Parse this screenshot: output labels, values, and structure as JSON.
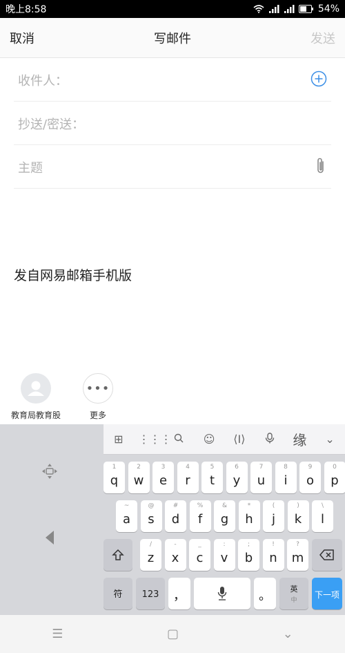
{
  "status": {
    "time": "晚上8:58",
    "battery": "54%"
  },
  "header": {
    "cancel": "取消",
    "title": "写邮件",
    "send": "发送"
  },
  "form": {
    "recipients_label": "收件人：",
    "cc_label": "抄送/密送：",
    "subject_placeholder": "主题"
  },
  "body": {
    "signature": "发自网易邮箱手机版"
  },
  "contacts": [
    {
      "name": "教育局教育股"
    },
    {
      "name": "更多"
    }
  ],
  "keyboard": {
    "toolbar_pinyin": "缘",
    "row1": [
      {
        "k": "q",
        "s": "1"
      },
      {
        "k": "w",
        "s": "2"
      },
      {
        "k": "e",
        "s": "3"
      },
      {
        "k": "r",
        "s": "4"
      },
      {
        "k": "t",
        "s": "5"
      },
      {
        "k": "y",
        "s": "6"
      },
      {
        "k": "u",
        "s": "7"
      },
      {
        "k": "i",
        "s": "8"
      },
      {
        "k": "o",
        "s": "9"
      },
      {
        "k": "p",
        "s": "0"
      }
    ],
    "row2": [
      {
        "k": "a",
        "s": "~"
      },
      {
        "k": "s",
        "s": "@"
      },
      {
        "k": "d",
        "s": "#"
      },
      {
        "k": "f",
        "s": "%"
      },
      {
        "k": "g",
        "s": "&"
      },
      {
        "k": "h",
        "s": "*"
      },
      {
        "k": "j",
        "s": "("
      },
      {
        "k": "k",
        "s": ")"
      },
      {
        "k": "l",
        "s": "\\"
      }
    ],
    "row3": [
      {
        "k": "z",
        "s": "/"
      },
      {
        "k": "x",
        "s": "-"
      },
      {
        "k": "c",
        "s": "_"
      },
      {
        "k": "v",
        "s": ":"
      },
      {
        "k": "b",
        "s": ";"
      },
      {
        "k": "n",
        "s": "!"
      },
      {
        "k": "m",
        "s": "?"
      }
    ],
    "symbol_key": "符",
    "num_key": "123",
    "comma_key": "，",
    "period_key": "。",
    "lang_key": "英",
    "lang_key_sub": "中",
    "next_key": "下一项"
  },
  "navbar": {
    "menu": "☰",
    "home": "▢",
    "back": "⌄"
  }
}
